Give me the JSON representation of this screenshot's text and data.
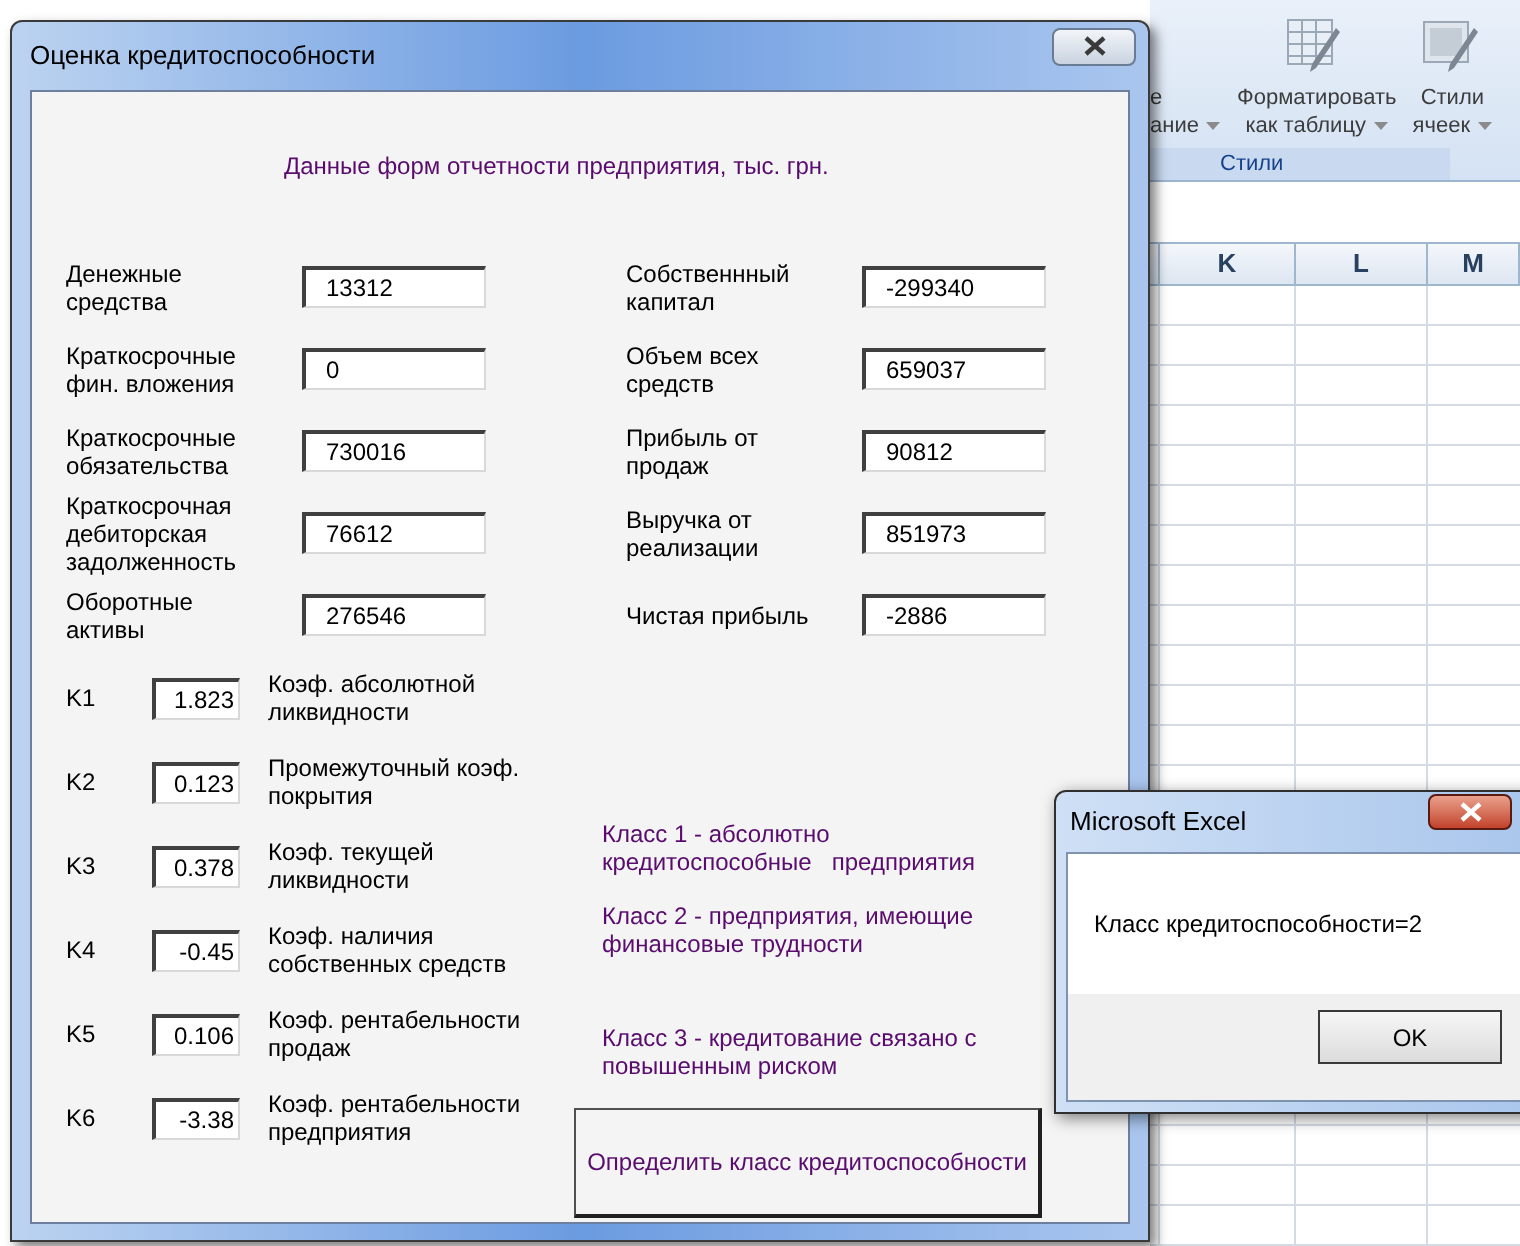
{
  "excel": {
    "ribbon_buttons": [
      {
        "lines": [
          "е",
          "ание"
        ],
        "kind": "partial",
        "dropdown": true
      },
      {
        "lines": [
          "Форматировать",
          "как таблицу"
        ],
        "kind": "table",
        "dropdown": true
      },
      {
        "lines": [
          "Стили",
          "ячеек"
        ],
        "kind": "cells",
        "dropdown": true
      }
    ],
    "ribbon_group": "Стили",
    "columns": [
      "K",
      "L",
      "M"
    ]
  },
  "dialog": {
    "title": "Оценка кредитоспособности",
    "heading": "Данные форм отчетности предприятия, тыс. грн.",
    "inputs_left": [
      {
        "label": "Денежные средства",
        "value": "13312"
      },
      {
        "label": "Краткосрочные фин. вложения",
        "value": "0"
      },
      {
        "label": "Краткосрочные обязательства",
        "value": "730016"
      },
      {
        "label": "Краткосрочная дебиторская задолженность",
        "value": "76612"
      },
      {
        "label": "Оборотные активы",
        "value": "276546"
      }
    ],
    "inputs_right": [
      {
        "label": "Собственнный капитал",
        "value": "-299340"
      },
      {
        "label": "Объем всех средств",
        "value": "659037"
      },
      {
        "label": "Прибыль от продаж",
        "value": "90812"
      },
      {
        "label": "Выручка от реализации",
        "value": "851973"
      },
      {
        "label": "Чистая прибыль",
        "value": "-2886"
      }
    ],
    "coefficients": [
      {
        "name": "K1",
        "value": "1.823",
        "description": "Коэф. абсолютной ликвидности"
      },
      {
        "name": "K2",
        "value": "0.123",
        "description": "Промежуточный коэф. покрытия"
      },
      {
        "name": "K3",
        "value": "0.378",
        "description": "Коэф. текущей ликвидности"
      },
      {
        "name": "K4",
        "value": "-0.45",
        "description": "Коэф. наличия собственных средств"
      },
      {
        "name": "K5",
        "value": "0.106",
        "description": "Коэф. рентабельности продаж"
      },
      {
        "name": "K6",
        "value": "-3.38",
        "description": "Коэф. рентабельности предприятия"
      }
    ],
    "classes": [
      "Класс 1 - абсолютно кредитоспособные   предприятия",
      "Класс 2 - предприятия, имеющие финансовые трудности",
      "Класс 3 - кредитование связано с повышенным риском"
    ],
    "button": "Определить класс кредитоспособности"
  },
  "message_box": {
    "title": "Microsoft Excel",
    "message": "Класс кредитоспособности=2",
    "button": "OK"
  }
}
